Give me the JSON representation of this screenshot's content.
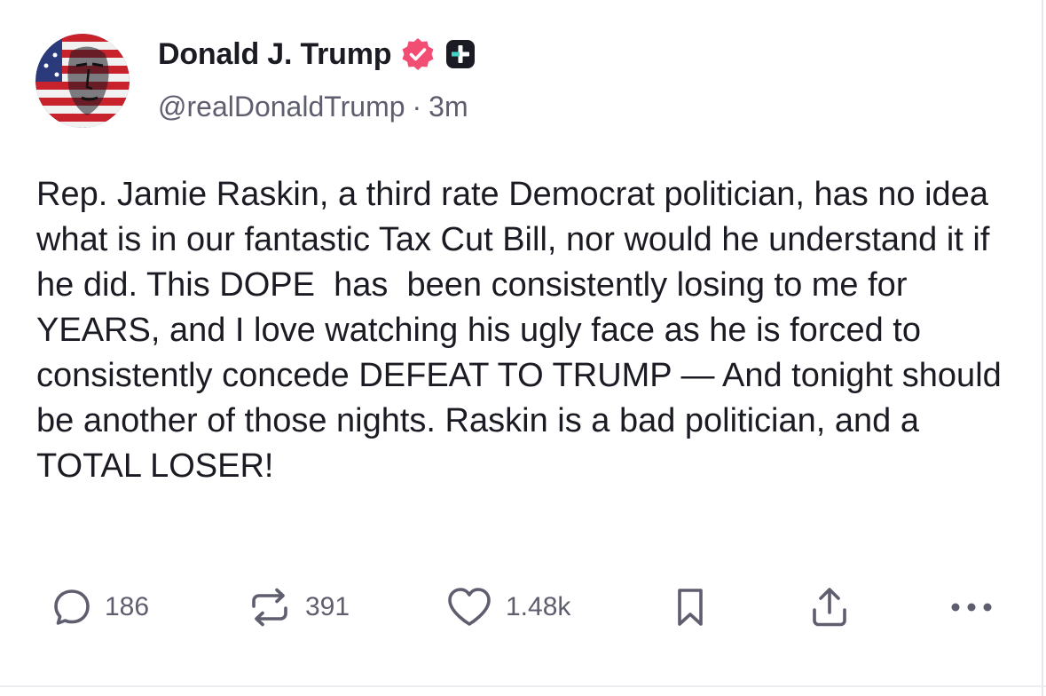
{
  "post": {
    "author": {
      "display_name": "Donald J. Trump",
      "handle": "@realDonaldTrump",
      "separator": "·",
      "time_ago": "3m",
      "avatar_icon": "flag-portrait-avatar",
      "verified_icon": "verified-badge-icon",
      "verified_color": "#f24e73",
      "plus_icon": "plus-badge-icon",
      "plus_color": "#1b1b24"
    },
    "text": "Rep. Jamie Raskin, a third rate Democrat politician, has no idea what is in our fantastic Tax Cut Bill, nor would he understand it if he did. This DOPE  has  been consistently losing to me for YEARS, and I love watching his ugly face as he is forced to consistently concede DEFEAT TO TRUMP — And tonight should be another of those nights. Raskin is a bad politician, and a TOTAL LOSER!"
  },
  "actions": {
    "replies": {
      "count": "186",
      "icon": "reply-bubble-icon"
    },
    "reposts": {
      "count": "391",
      "icon": "repost-icon"
    },
    "likes": {
      "count": "1.48k",
      "icon": "heart-icon"
    },
    "bookmark": {
      "icon": "bookmark-icon"
    },
    "share": {
      "icon": "share-icon"
    },
    "more": {
      "icon": "more-icon"
    }
  },
  "colors": {
    "text_primary": "#1b1b24",
    "text_secondary": "#5e5e6e",
    "icon": "#5e5e6e"
  }
}
